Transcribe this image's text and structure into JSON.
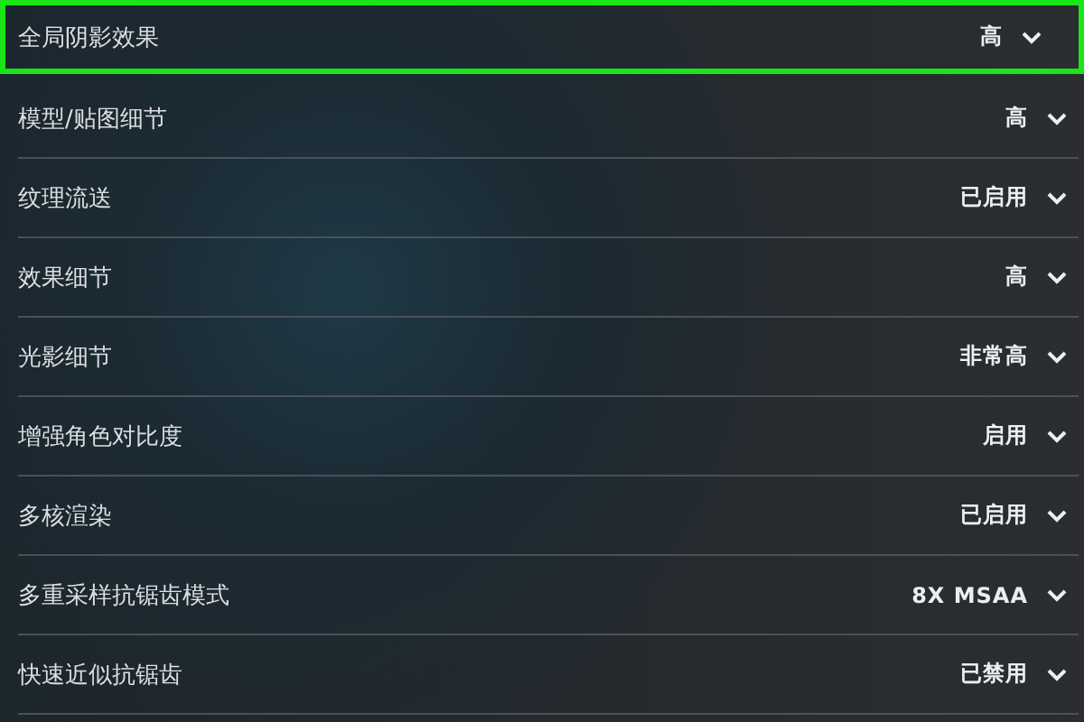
{
  "settings": [
    {
      "label": "全局阴影效果",
      "value": "高",
      "selected": true
    },
    {
      "label": "模型/贴图细节",
      "value": "高",
      "selected": false
    },
    {
      "label": "纹理流送",
      "value": "已启用",
      "selected": false
    },
    {
      "label": "效果细节",
      "value": "高",
      "selected": false
    },
    {
      "label": "光影细节",
      "value": "非常高",
      "selected": false
    },
    {
      "label": "增强角色对比度",
      "value": "启用",
      "selected": false
    },
    {
      "label": "多核渲染",
      "value": "已启用",
      "selected": false
    },
    {
      "label": "多重采样抗锯齿模式",
      "value": "8X MSAA",
      "selected": false
    },
    {
      "label": "快速近似抗锯齿",
      "value": "已禁用",
      "selected": false
    }
  ]
}
